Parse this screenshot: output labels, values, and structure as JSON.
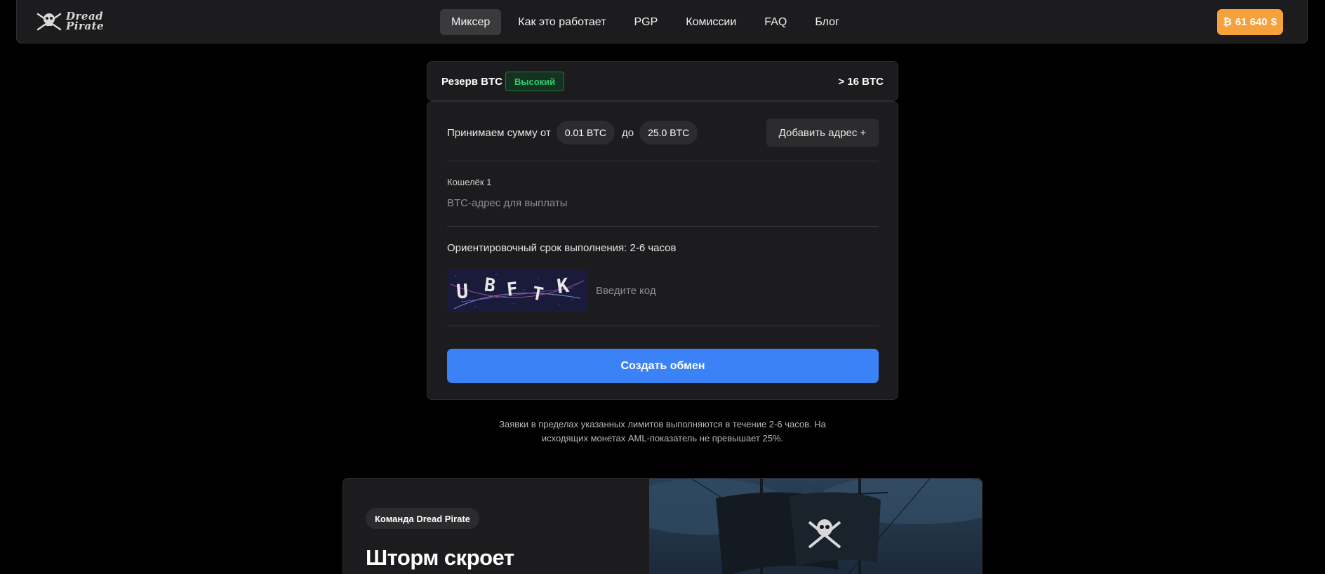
{
  "header": {
    "logo_text_line1": "Dread",
    "logo_text_line2": "Pirate",
    "logo_icon": "skull-crossbones-icon",
    "nav": [
      {
        "label": "Миксер",
        "active": true
      },
      {
        "label": "Как это работает",
        "active": false
      },
      {
        "label": "PGP",
        "active": false
      },
      {
        "label": "Комиссии",
        "active": false
      },
      {
        "label": "FAQ",
        "active": false
      },
      {
        "label": "Блог",
        "active": false
      }
    ],
    "btc_price": {
      "symbol": "₿",
      "value": "61 640",
      "currency": "$",
      "color": "#f7a13c"
    }
  },
  "reserve": {
    "label": "Резерв BTC",
    "badge": "Высокий",
    "badge_color": "#2ecc71",
    "value": "> 16 BTC"
  },
  "form": {
    "accept_prefix": "Принимаем сумму от",
    "min": "0.01 BTC",
    "to": "до",
    "max": "25.0 BTC",
    "add_address_label": "Добавить адрес +",
    "wallet_label": "Кошелёк 1",
    "wallet_placeholder": "BTC-адрес для выплаты",
    "eta": "Ориентировочный срок выполнения: 2-6 часов",
    "captcha_text": "UBFTK",
    "captcha_placeholder": "Введите код",
    "submit_label": "Создать обмен",
    "submit_color": "#3b82f6"
  },
  "note": {
    "line1": "Заявки в пределах указанных лимитов выполняются в течение 2-6 часов. На",
    "line2": "исходящих монетах AML-показатель не превышает 25%."
  },
  "promo": {
    "badge": "Команда Dread Pirate",
    "title": "Шторм скроет",
    "image": "pirate-ship-illustration"
  }
}
